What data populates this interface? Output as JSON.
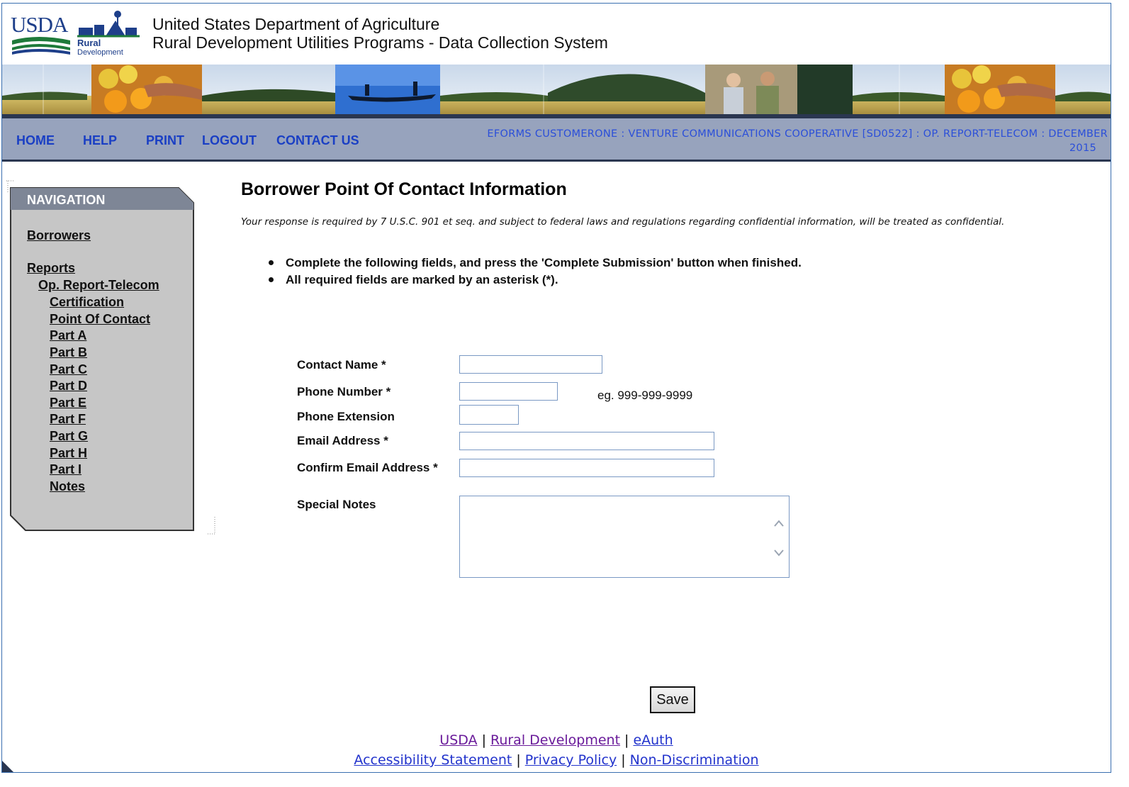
{
  "header": {
    "logo_usda": "USDA",
    "logo_rural": "Rural",
    "logo_development": "Development",
    "title_line1": "United States Department of Agriculture",
    "title_line2": "Rural Development Utilities Programs - Data Collection System"
  },
  "navbar": {
    "home": "HOME",
    "help": "HELP",
    "print": "PRINT",
    "logout": "LOGOUT",
    "contact_us": "CONTACT US",
    "context_line1": "EFORMS CUSTOMERONE : VENTURE COMMUNICATIONS COOPERATIVE [SD0522] : OP. REPORT-TELECOM : DECEMBER",
    "context_line2": "2015"
  },
  "navigation": {
    "heading": "NAVIGATION",
    "borrowers": "Borrowers",
    "reports": "Reports",
    "op_report": "Op. Report-Telecom",
    "items": [
      "Certification",
      "Point Of Contact",
      "Part A",
      "Part B",
      "Part C",
      "Part D",
      "Part E",
      "Part F",
      "Part G",
      "Part H",
      "Part I",
      "Notes"
    ]
  },
  "main": {
    "title": "Borrower Point Of Contact Information",
    "notice": "Your response is required by 7 U.S.C. 901 et seq. and subject to federal laws and regulations regarding confidential information, will be treated as confidential.",
    "instructions": [
      "Complete the following fields, and press the 'Complete Submission' button when finished.",
      "All required fields are marked by an asterisk (*)."
    ]
  },
  "form": {
    "contact_name_label": "Contact Name *",
    "contact_name_value": "",
    "phone_number_label": "Phone Number *",
    "phone_number_value": "",
    "phone_hint": "eg. 999-999-9999",
    "phone_extension_label": "Phone Extension",
    "phone_extension_value": "",
    "email_label": "Email Address *",
    "email_value": "",
    "confirm_email_label": "Confirm Email Address *",
    "confirm_email_value": "",
    "special_notes_label": "Special Notes",
    "special_notes_value": "",
    "save_label": "Save"
  },
  "footer": {
    "usda": "USDA",
    "rural_development": "Rural Development",
    "eauth": "eAuth",
    "accessibility": "Accessibility Statement",
    "privacy": "Privacy Policy",
    "non_discrimination": "Non-Discrimination",
    "separator": "|"
  },
  "colors": {
    "navbar_bg": "#97a3bd",
    "nav_link": "#1a3fc4",
    "panel_bg": "#c6c6c6",
    "panel_header": "#7e8696",
    "border_blue": "#3a6fb0"
  }
}
